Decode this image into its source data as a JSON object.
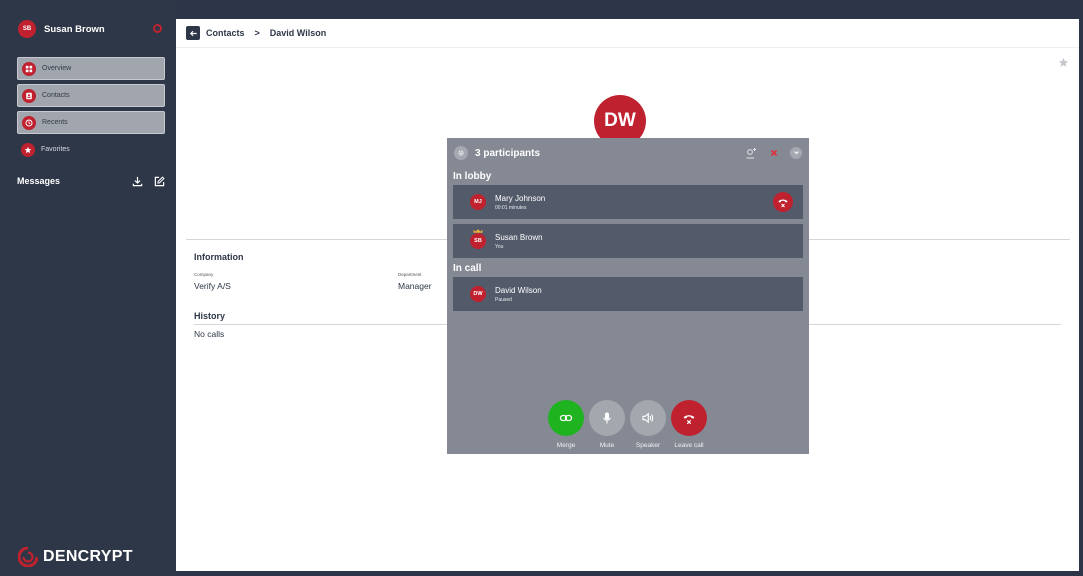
{
  "user": {
    "initials": "SB",
    "name": "Susan Brown"
  },
  "nav": {
    "overview": "Overview",
    "contacts": "Contacts",
    "recents": "Recents",
    "favorites": "Favorites"
  },
  "messages": {
    "label": "Messages"
  },
  "logo": {
    "text": "DENCRYPT"
  },
  "breadcrumb": {
    "parent": "Contacts",
    "separator": ">",
    "current": "David Wilson"
  },
  "contact": {
    "initials": "DW",
    "info_title": "Information",
    "company_label": "Company",
    "company_value": "Verify A/S",
    "department_label": "Department",
    "department_value": "Manager",
    "history_title": "History",
    "history_empty": "No calls"
  },
  "call": {
    "title": "3 participants",
    "lobby_title": "In lobby",
    "incall_title": "In call",
    "lobby": [
      {
        "initials": "MJ",
        "name": "Mary Johnson",
        "sub": "00:01 minutes"
      },
      {
        "initials": "SB",
        "name": "Susan Brown",
        "sub": "You"
      }
    ],
    "in_call": [
      {
        "initials": "DW",
        "name": "David Wilson",
        "sub": "Paused"
      }
    ],
    "controls": {
      "merge": "Merge",
      "mute": "Mute",
      "speaker": "Speaker",
      "leave": "Leave call"
    }
  },
  "colors": {
    "brand_red": "#c0212f",
    "sidebar_bg": "#2e3748",
    "merge_green": "#1fb320",
    "panel_bg": "#848993"
  }
}
